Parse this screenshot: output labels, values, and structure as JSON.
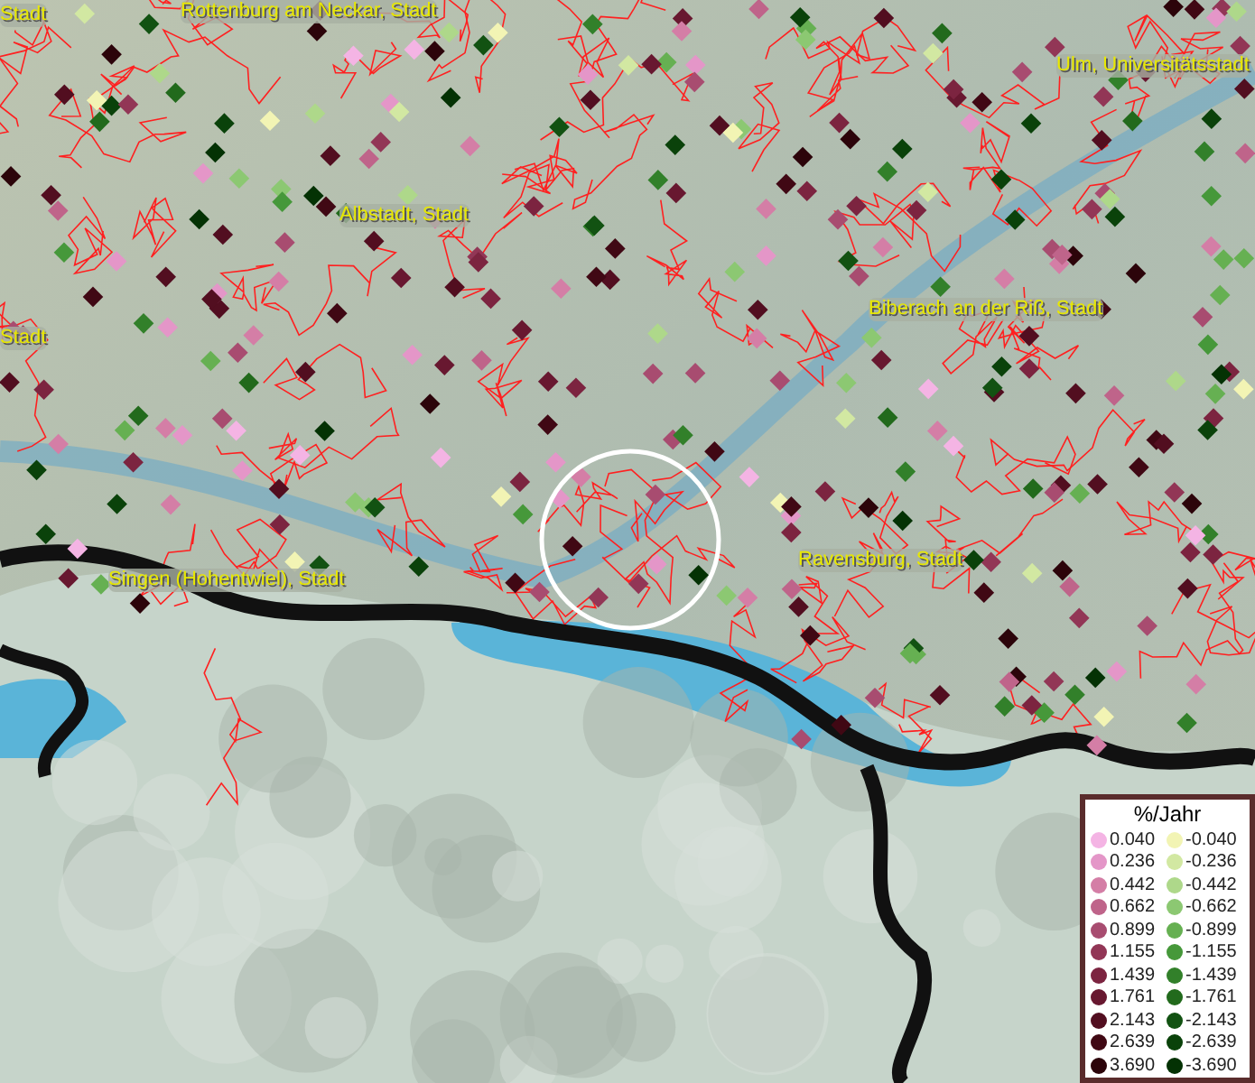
{
  "map_labels": [
    {
      "text": "Stadt"
    },
    {
      "text": "Rottenburg am Neckar, Stadt"
    },
    {
      "text": "Ulm, Universitätsstadt"
    },
    {
      "text": "Albstadt, Stadt"
    },
    {
      "text": "Stadt"
    },
    {
      "text": "Biberach an der Riß, Stadt"
    },
    {
      "text": "Singen (Hohentwiel), Stadt"
    },
    {
      "text": "Ravensburg, Stadt"
    }
  ],
  "legend": {
    "title": "%/Jahr",
    "positive": [
      {
        "label": "0.040",
        "color": "#f4b4e4"
      },
      {
        "label": "0.236",
        "color": "#e496c8"
      },
      {
        "label": "0.442",
        "color": "#d47ea6"
      },
      {
        "label": "0.662",
        "color": "#bf648a"
      },
      {
        "label": "0.899",
        "color": "#a84c70"
      },
      {
        "label": "1.155",
        "color": "#923656"
      },
      {
        "label": "1.439",
        "color": "#7c2440"
      },
      {
        "label": "1.761",
        "color": "#681830"
      },
      {
        "label": "2.143",
        "color": "#520e20"
      },
      {
        "label": "2.639",
        "color": "#400814"
      },
      {
        "label": "3.690",
        "color": "#2c040a"
      }
    ],
    "negative": [
      {
        "label": "-0.040",
        "color": "#f2f4b4"
      },
      {
        "label": "-0.236",
        "color": "#d2e8a2"
      },
      {
        "label": "-0.442",
        "color": "#aed88a"
      },
      {
        "label": "-0.662",
        "color": "#8cc872"
      },
      {
        "label": "-0.899",
        "color": "#66b052"
      },
      {
        "label": "-1.155",
        "color": "#46983a"
      },
      {
        "label": "-1.439",
        "color": "#32802a"
      },
      {
        "label": "-1.761",
        "color": "#226a1c"
      },
      {
        "label": "-2.143",
        "color": "#125212"
      },
      {
        "label": "-2.639",
        "color": "#0a420a"
      },
      {
        "label": "-3.690",
        "color": "#043204"
      }
    ]
  }
}
